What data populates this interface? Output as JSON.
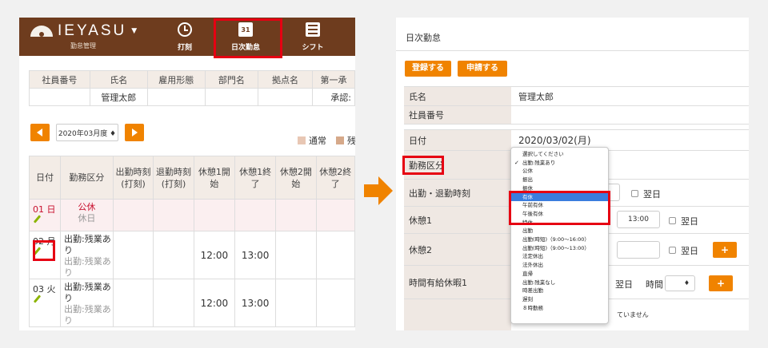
{
  "left": {
    "logo_text": "IEYASU",
    "logo_caret": "▼",
    "logo_sub": "勤怠管理",
    "nav": [
      {
        "label": "打刻",
        "icon": "clock-icon"
      },
      {
        "label": "日次勤怠",
        "icon": "calendar-icon",
        "calendar_number": "31"
      },
      {
        "label": "シフト",
        "icon": "shift-book-icon"
      }
    ],
    "info_headers": [
      "社員番号",
      "氏名",
      "雇用形態",
      "部門名",
      "拠点名",
      "第一承"
    ],
    "info_values": [
      "",
      "管理太郎",
      "",
      "",
      "",
      "承認:"
    ],
    "month": "2020年03月度 ♦",
    "legend": [
      {
        "label": "通常",
        "color": "#e8c7b4"
      },
      {
        "label": "残",
        "color": "#d6a98a"
      }
    ],
    "table_headers": [
      "日付",
      "勤務区分",
      "出勤時刻\n(打刻)",
      "退勤時刻\n(打刻)",
      "休憩1開\n始",
      "休憩1終\n了",
      "休憩2開\n始",
      "休憩2終\n了"
    ],
    "rows": [
      {
        "date": "01 日",
        "kubun": "公休",
        "sub": "休日",
        "b1s": "",
        "b1e": ""
      },
      {
        "date": "02 月",
        "kubun": "出勤:残業あ\nり",
        "sub": "出勤:残業あ\nり",
        "b1s": "12:00",
        "b1e": "13:00"
      },
      {
        "date": "03 火",
        "kubun": "出勤:残業あ\nり",
        "sub": "出勤:残業あ\nり",
        "b1s": "12:00",
        "b1e": "13:00"
      }
    ],
    "accent": "#f08300",
    "header_brown": "#6e3c1e",
    "highlight_red": "#e60012"
  },
  "right": {
    "title": "日次勤怠",
    "register_label": "登録する",
    "apply_label": "申請する",
    "fields": {
      "name_label": "氏名",
      "name_value": "管理太郎",
      "emp_no_label": "社員番号",
      "date_label": "日付",
      "date_value": "2020/03/02(月)",
      "kubun_label": "勤務区分",
      "inout_label": "出勤・退勤時刻",
      "break1_label": "休憩1",
      "break2_label": "休憩2",
      "hourly_leave_label": "時間有給休暇1"
    },
    "break1_time": "13:00",
    "next_day_label": "翌日",
    "time_label": "時間",
    "plus_label": "+",
    "select_caret": "♦",
    "partial_note": "ていません",
    "dropdown_items": [
      "選択してください",
      "出勤:残業あり",
      "公休",
      "振出",
      "振休",
      "有休",
      "午前有休",
      "午後有休",
      "特休",
      "出勤",
      "出勤(時短)（9:00〜16:00）",
      "出勤(時短)（9:00〜13:00）",
      "法定休出",
      "法外休出",
      "直帰",
      "出勤:残業なし",
      "時差出勤",
      "遅刻",
      "８時勤務"
    ],
    "dropdown_checked_index": 1,
    "dropdown_selected_index": 5,
    "check_mark": "✓"
  }
}
